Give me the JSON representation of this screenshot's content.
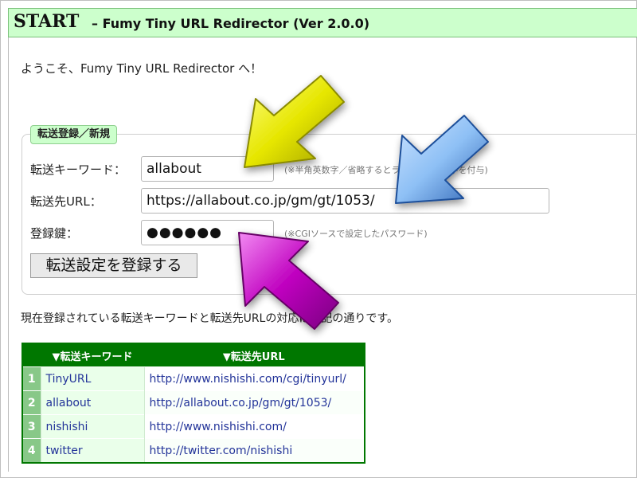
{
  "header": {
    "start": "START",
    "subtitle": "– Fumy Tiny URL Redirector (Ver 2.0.0)"
  },
  "welcome": "ようこそ、Fumy Tiny URL Redirector へ！",
  "form": {
    "legend": "転送登録／新規",
    "keyword_label": "転送キーワード：",
    "keyword_value": "allabout",
    "keyword_hint": "(※半角英数字／省略するとランダムな8文字を付与)",
    "url_label": "転送先URL：",
    "url_value": "https://allabout.co.jp/gm/gt/1053/",
    "key_label": "登録鍵：",
    "key_value": "●●●●●●",
    "key_hint": "(※CGIソースで設定したパスワード)",
    "submit_label": "転送設定を登録する"
  },
  "description": "現在登録されている転送キーワードと転送先URLの対応は下記の通りです。",
  "table": {
    "headers": [
      "",
      "▼転送キーワード",
      "▼転送先URL"
    ],
    "rows": [
      {
        "num": "1",
        "keyword": "TinyURL",
        "url": "http://www.nishishi.com/cgi/tinyurl/"
      },
      {
        "num": "2",
        "keyword": "allabout",
        "url": "http://allabout.co.jp/gm/gt/1053/"
      },
      {
        "num": "3",
        "keyword": "nishishi",
        "url": "http://www.nishishi.com/"
      },
      {
        "num": "4",
        "keyword": "twitter",
        "url": "http://twitter.com/nishishi"
      }
    ]
  },
  "colors": {
    "header_bg": "#ccffcc",
    "table_green": "#007700",
    "arrow_yellow": "#e6e600",
    "arrow_blue": "#4b86d6",
    "arrow_purple": "#b000b0"
  }
}
